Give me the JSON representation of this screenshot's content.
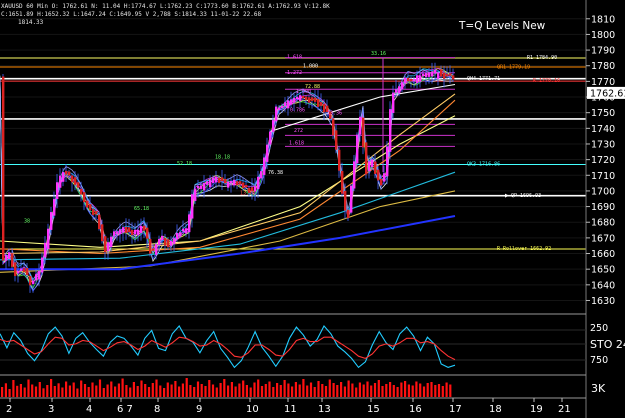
{
  "header": {
    "line1": "XAUUSD 60 Min  O: 1762.61  N:    11.04  H:1774.67  L:1762.23  C:1773.60  B:1762.61  A:1762.93  V:12.8K",
    "line2": "C:1651.89  H:1652.32  L:1647.24  C:1649.95  V 2,788  S:1814.33  11-01-22  22.68",
    "line3": "1814.33"
  },
  "chart_data": [
    {
      "type": "candlestick",
      "title": "T=Q Levels New",
      "symbol": "XAUUSD",
      "timeframe": "60 Min",
      "ylim": [
        1622,
        1822
      ],
      "y_ticks": [
        1630,
        1640,
        1650,
        1660,
        1670,
        1680,
        1690,
        1700,
        1710,
        1720,
        1730,
        1740,
        1750,
        1760,
        1770,
        1780,
        1790,
        1800,
        1810
      ],
      "last_price": "1762.61",
      "x_ticks": [
        "2",
        "3",
        "4",
        "6 7",
        "8",
        "9",
        "10",
        "11",
        "13",
        "15",
        "16",
        "17",
        "18",
        "19",
        "21"
      ],
      "level_labels": [
        {
          "text": "1.618",
          "color": "#ff55ff"
        },
        {
          "text": "1.272",
          "color": "#ff55ff"
        },
        {
          "text": "1.000",
          "color": "#ff55ff"
        },
        {
          "text": "0.786",
          "color": "#ff55ff"
        },
        {
          "text": "272",
          "color": "#ff55ff"
        },
        {
          "text": "1.618",
          "color": "#ff55ff"
        },
        {
          "text": "33.16",
          "color": "#66ff66"
        },
        {
          "text": "52.18",
          "color": "#66ff66"
        },
        {
          "text": "18.18",
          "color": "#66ff66"
        },
        {
          "text": "65.18",
          "color": "#66ff66"
        },
        {
          "text": "38",
          "color": "#66ff66"
        },
        {
          "text": "72.88",
          "color": "#ffff66"
        },
        {
          "text": "13.36",
          "color": "#ff55ff"
        },
        {
          "text": "13.78",
          "color": "#ff4444"
        },
        {
          "text": "76.38",
          "color": "#ffffff"
        },
        {
          "text": "1.000",
          "color": "#ffffff"
        },
        {
          "text": "R1 1784.90",
          "color": "#ffffff"
        },
        {
          "text": "QR1 1779.19",
          "color": "#ff8800"
        },
        {
          "text": "QH4 1771.71",
          "color": "#ffffff"
        },
        {
          "text": "R 1770.16",
          "color": "#ff3333"
        },
        {
          "text": "QK3 1716.86",
          "color": "#44ffff"
        },
        {
          "text": "QP 1696.93",
          "color": "#ffffff"
        },
        {
          "text": "R Rollover 1662.92",
          "color": "#ffff55"
        }
      ],
      "horizontal_levels": [
        {
          "value": 1784.9,
          "color": "#ffff66",
          "name": "R1"
        },
        {
          "value": 1779.19,
          "color": "#ff8800",
          "name": "QR1"
        },
        {
          "value": 1771.71,
          "color": "#ffffff",
          "name": "QH4"
        },
        {
          "value": 1770.16,
          "color": "#ff3333",
          "name": "R"
        },
        {
          "value": 1746,
          "color": "#ffffff",
          "name": ""
        },
        {
          "value": 1716.86,
          "color": "#44ffff",
          "name": "QK3"
        },
        {
          "value": 1696.93,
          "color": "#ffffff",
          "name": "QP"
        },
        {
          "value": 1662.92,
          "color": "#ffff55",
          "name": "R Rollover"
        }
      ]
    },
    {
      "type": "line",
      "name": "STO",
      "label": "STO  24",
      "y_ticks": [
        "250",
        "750"
      ],
      "series": [
        {
          "color": "#22ccff",
          "values": [
            70,
            45,
            72,
            58,
            35,
            22,
            40,
            70,
            82,
            66,
            35,
            62,
            72,
            55,
            42,
            30,
            55,
            66,
            62,
            48,
            32,
            62,
            76,
            44,
            40,
            70,
            84,
            62,
            55,
            36,
            58,
            74,
            44,
            28,
            10,
            22,
            46,
            74,
            46,
            30,
            12,
            30,
            62,
            82,
            68,
            48,
            60,
            84,
            70,
            48,
            38,
            26,
            10,
            20,
            50,
            74,
            54,
            42,
            70,
            82,
            66,
            40,
            64,
            52,
            16,
            10,
            14
          ]
        },
        {
          "color": "#ff3333",
          "values": [
            60,
            56,
            58,
            50,
            42,
            34,
            38,
            52,
            64,
            62,
            50,
            52,
            58,
            56,
            48,
            40,
            46,
            54,
            56,
            50,
            42,
            48,
            58,
            52,
            46,
            54,
            64,
            62,
            56,
            48,
            50,
            58,
            52,
            42,
            30,
            28,
            36,
            50,
            50,
            42,
            32,
            30,
            42,
            58,
            62,
            56,
            56,
            64,
            64,
            56,
            48,
            40,
            30,
            26,
            34,
            48,
            52,
            48,
            54,
            62,
            62,
            54,
            56,
            52,
            40,
            30,
            24
          ]
        }
      ]
    },
    {
      "type": "bar",
      "name": "Volume",
      "y_tick": "3K",
      "color": "#ff1111",
      "values": [
        40,
        55,
        32,
        68,
        45,
        52,
        38,
        70,
        50,
        42,
        60,
        35,
        48,
        72,
        44,
        55,
        38,
        62,
        46,
        58,
        34,
        66,
        52,
        40,
        58,
        46,
        70,
        36,
        50,
        62,
        42,
        54,
        74,
        48,
        38,
        60,
        44,
        66,
        52,
        40,
        56,
        70,
        46,
        36,
        58,
        50,
        64,
        42,
        54,
        76,
        48,
        40,
        62,
        52,
        44,
        68,
        50,
        38,
        56,
        72,
        46,
        60,
        42,
        54,
        66,
        48,
        38,
        58,
        70,
        44,
        52,
        62,
        40,
        56,
        48,
        68,
        54,
        42,
        60,
        50,
        72,
        46,
        58,
        40,
        64,
        52,
        44,
        70,
        56,
        48,
        60,
        42,
        66,
        54,
        38,
        58,
        50,
        62,
        46,
        56,
        68,
        44,
        52,
        60,
        48,
        40,
        58,
        64,
        50,
        46,
        62,
        54,
        42,
        56,
        60,
        48,
        52,
        44,
        58,
        50
      ]
    }
  ]
}
